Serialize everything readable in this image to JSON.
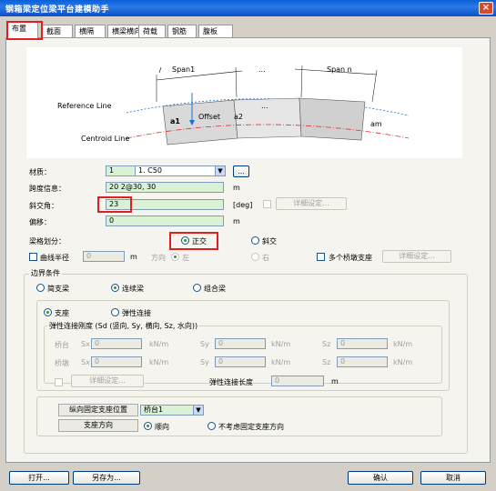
{
  "window": {
    "title": "钢箱梁定位梁平台建模助手",
    "close": "×"
  },
  "tabs": [
    "布置",
    "截面",
    "横隔",
    "横梁横向",
    "荷载",
    "钢筋",
    "腹板"
  ],
  "diagram": {
    "span1": "Span1",
    "dots_top": "...",
    "spann": "Span n",
    "reference_line": "Reference Line",
    "centroid_line": "Centroid Line",
    "offset": "Offset",
    "a1": "a1",
    "a2": "a2",
    "dots_mid": "...",
    "an": "am"
  },
  "form": {
    "material_label": "材质：",
    "material_value": "1. C50",
    "material_button": "...",
    "span_label": "跨度信息：",
    "span_value": "20  2@30, 30",
    "span_unit": "m",
    "skew_label": "斜交角：",
    "skew_value": "23",
    "skew_unit": "[deg]",
    "detail_btn": "详细设定...",
    "offset_label": "偏移：",
    "offset_value": "0",
    "offset_unit": "m",
    "division_label": "梁格划分：",
    "radio_orthogonal": "正交",
    "radio_skew": "斜交",
    "curve_label": "曲线半径",
    "curve_value": "0",
    "curve_unit": "m",
    "curve_direction": "方向",
    "radio_left": "左",
    "radio_right": "右",
    "multi_support_label": "多个桥墩支座",
    "multi_support_btn": "详细设定..."
  },
  "boundary": {
    "title": "边界条件",
    "radio_simple": "简支梁",
    "radio_continuous": "连续梁",
    "radio_mixed": "组合梁",
    "inner_radio_support": "支座",
    "inner_radio_elastic": "弹性连接",
    "stiffness_title": "弹性连接刚度 (Sd  (竖向, Sy, 横向, Sz, 水向))",
    "row1_label": "桥台",
    "row2_label": "桥墩",
    "sx": "Sx",
    "sy": "Sy",
    "sz": "Sz",
    "val": "0",
    "unit_sx": "kN/m",
    "unit_sy": "kN/m",
    "unit_sz": "kN/m",
    "detail_btn": "详细设定...",
    "elastic_length_label": "弹性连接长度",
    "elastic_length_value": "0",
    "elastic_length_unit": "m"
  },
  "position": {
    "position_label": "纵向固定支座位置",
    "position_value": "桥台1",
    "direction_label": "支座方向",
    "radio_forward": "顺向",
    "radio_reverse": "不考虑固定支座方向"
  },
  "footer": {
    "open": "打开...",
    "save_as": "另存为...",
    "ok": "确认",
    "cancel": "取消"
  }
}
